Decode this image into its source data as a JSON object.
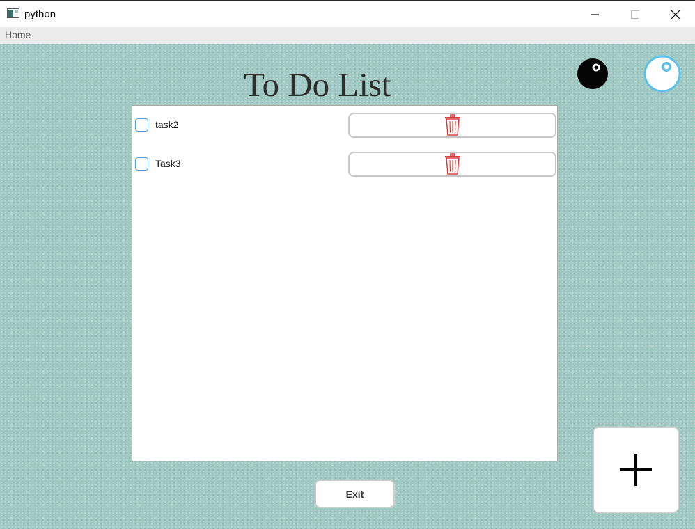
{
  "window": {
    "title": "python",
    "icon": "app-window-icon",
    "controls": [
      "minimize-icon",
      "maximize-icon",
      "close-icon"
    ]
  },
  "menu": {
    "home_label": "Home"
  },
  "page": {
    "title": "To Do List"
  },
  "theme_buttons": {
    "dark": "dark-theme-icon",
    "light": "light-theme-icon"
  },
  "tasks": [
    {
      "label": "task2",
      "checked": false,
      "delete_icon": "trash-icon"
    },
    {
      "label": "Task3",
      "checked": false,
      "delete_icon": "trash-icon"
    }
  ],
  "footer": {
    "exit_label": "Exit"
  },
  "add_button": {
    "icon": "plus-icon"
  },
  "colors": {
    "background": "#9fc8c3",
    "checkbox_border": "#4a9be0",
    "delete_icon": "#e03b3b",
    "light_theme_accent": "#5bc0e8"
  }
}
